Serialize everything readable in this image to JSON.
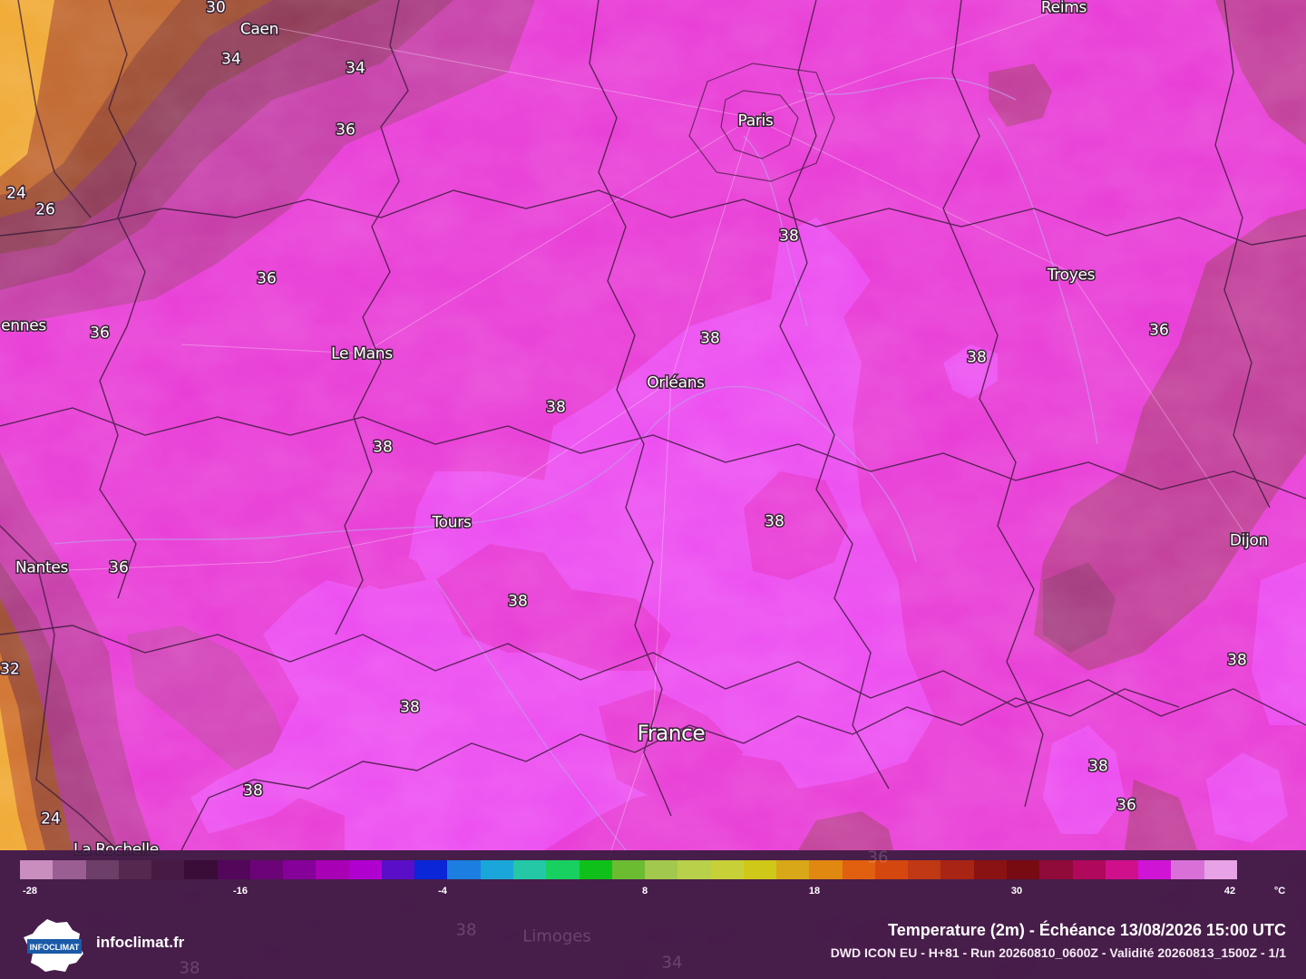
{
  "cities": [
    {
      "id": "caen",
      "label": "Caen"
    },
    {
      "id": "reims",
      "label": "Reims"
    },
    {
      "id": "paris",
      "label": "Paris"
    },
    {
      "id": "troyes",
      "label": "Troyes"
    },
    {
      "id": "rennes",
      "label": "ennes"
    },
    {
      "id": "le-mans",
      "label": "Le Mans"
    },
    {
      "id": "orleans",
      "label": "Orléans"
    },
    {
      "id": "tours",
      "label": "Tours"
    },
    {
      "id": "nantes",
      "label": "Nantes"
    },
    {
      "id": "dijon",
      "label": "Dijon"
    },
    {
      "id": "france",
      "label": "France"
    },
    {
      "id": "la-rochelle",
      "label": "La Rochelle"
    },
    {
      "id": "limoges",
      "label": "Limoges"
    }
  ],
  "isotherm_labels": [
    "30",
    "34",
    "34",
    "36",
    "24",
    "26",
    "36",
    "36",
    "38",
    "38",
    "38",
    "38",
    "36",
    "38",
    "38",
    "38",
    "36",
    "38",
    "38",
    "38",
    "38",
    "32",
    "38",
    "24",
    "38",
    "36",
    "36",
    "38",
    "38",
    "34"
  ],
  "legend": {
    "colors": [
      "#c98ebd",
      "#9a5e92",
      "#6c3e68",
      "#54284f",
      "#461a43",
      "#3a0d38",
      "#52075a",
      "#6c0478",
      "#86009a",
      "#a800b4",
      "#b000d0",
      "#5a0ec8",
      "#0a26d6",
      "#1c7ee0",
      "#1aa6d8",
      "#24c8a6",
      "#18d060",
      "#10c01a",
      "#6cbc32",
      "#a2c84e",
      "#b8d04a",
      "#c8d038",
      "#d0c818",
      "#d8a818",
      "#e08810",
      "#e06010",
      "#d44810",
      "#c03814",
      "#a82414",
      "#8a1212",
      "#780a14",
      "#900a3a",
      "#b0085a",
      "#d0108a",
      "#d014d6",
      "#d870d8",
      "#e8a2e6"
    ],
    "ticks": [
      "-28",
      "-16",
      "-4",
      "8",
      "18",
      "30",
      "42"
    ],
    "unit": "°C"
  },
  "brand": {
    "site": "infoclimat.fr",
    "logo_text": "INFOCLIMAT"
  },
  "caption": {
    "title": "Temperature (2m) - Échéance 13/08/2026 15:00 UTC",
    "subtitle": "DWD ICON EU - H+81 - Run 20260810_0600Z - Validité 20260813_1500Z - 1/1"
  }
}
